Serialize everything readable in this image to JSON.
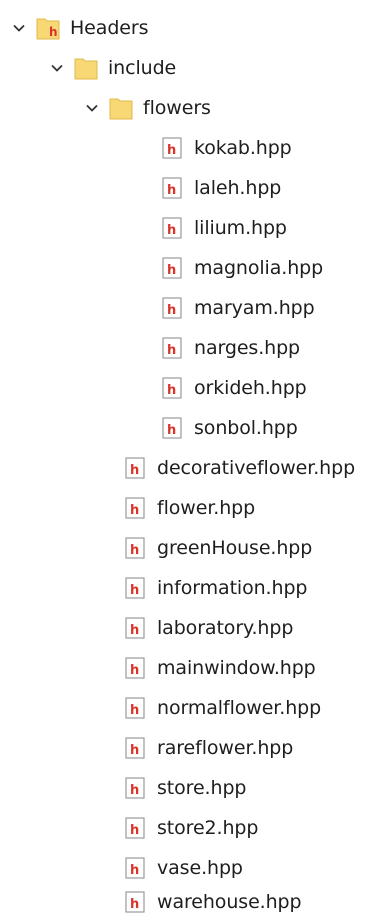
{
  "tree": {
    "root": {
      "label": "Headers",
      "icon": "header-folder-icon",
      "expanded": true,
      "children": {
        "include": {
          "label": "include",
          "icon": "folder-icon",
          "expanded": true,
          "children": {
            "flowers": {
              "label": "flowers",
              "icon": "folder-icon",
              "expanded": true,
              "files": [
                "kokab.hpp",
                "laleh.hpp",
                "lilium.hpp",
                "magnolia.hpp",
                "maryam.hpp",
                "narges.hpp",
                "orkideh.hpp",
                "sonbol.hpp"
              ]
            },
            "files": [
              "decorativeflower.hpp",
              "flower.hpp",
              "greenHouse.hpp",
              "information.hpp",
              "laboratory.hpp",
              "mainwindow.hpp",
              "normalflower.hpp",
              "rareflower.hpp",
              "store.hpp",
              "store2.hpp",
              "vase.hpp",
              "warehouse.hpp"
            ]
          }
        }
      }
    }
  },
  "colors": {
    "folder_yellow": "#F8D775",
    "folder_dark": "#E0B94A",
    "header_h_red": "#D9342B",
    "chevron": "#333333",
    "text": "#1E1E1E"
  }
}
